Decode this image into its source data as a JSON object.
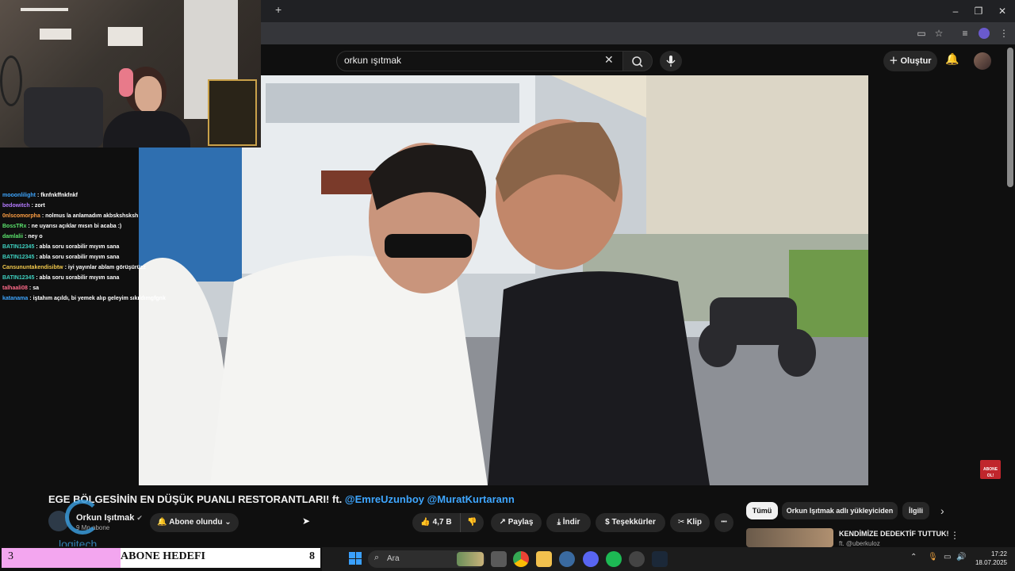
{
  "browser": {
    "new_tab": "+",
    "minimize": "–",
    "maximize": "❐",
    "close": "✕"
  },
  "youtube": {
    "search_value": "orkun ışıtmak",
    "create_label": "Oluştur",
    "video_title_main": "EGE BÖLGESİNİN EN DÜŞÜK PUANLI RESTORANTLARI! ft.",
    "video_title_tag1": "@EmreUzunboy",
    "video_title_tag2": "@MuratKurtarann",
    "channel_name": "Orkun Işıtmak",
    "channel_subs": "9 Mn abone",
    "subscribed_label": "Abone olundu",
    "likes": "4,7 B",
    "share": "Paylaş",
    "download": "İndir",
    "thanks": "Teşekkürler",
    "clip": "Klip",
    "more": "•••",
    "chips": [
      "Tümü",
      "Orkun Işıtmak adlı yükleyiciden",
      "İlgili"
    ],
    "rec_title": "KENDİMİZE DEDEKTİF TUTTUK!",
    "rec_sub": "ft. @uberkuloz",
    "sub_badge": "ABONE OL!"
  },
  "chat": [
    {
      "user": "mooonlilight",
      "msg": ": fknfnkffnkfnkf",
      "color": "#3ea6ff"
    },
    {
      "user": "bedowitch",
      "msg": ": zort",
      "color": "#b57bff"
    },
    {
      "user": "0nlscomorpha",
      "msg": ": nolmus la anlamadım akbskshsksh",
      "color": "#ff9f43"
    },
    {
      "user": "BossTRx",
      "msg": ": ne uyarısı açıklar mısın bi acaba :)",
      "color": "#5be36d"
    },
    {
      "user": "damlalii",
      "msg": ": ney o",
      "color": "#5be36d"
    },
    {
      "user": "BATIN12345",
      "msg": ": abla soru sorabilir mıyım sana",
      "color": "#3ed0c0"
    },
    {
      "user": "BATIN12345",
      "msg": ": abla soru sorabilir mıyım sana",
      "color": "#3ed0c0"
    },
    {
      "user": "Cansununtakendisibtw",
      "msg": ": iyi yayınlar ablam görüşürüzz",
      "color": "#f2c94c"
    },
    {
      "user": "BATIN12345",
      "msg": ": abla soru sorabilir mıyım sana",
      "color": "#3ed0c0"
    },
    {
      "user": "talhaali08",
      "msg": ": sa",
      "color": "#ff6b8a"
    },
    {
      "user": "katanama",
      "msg": ": iştahım açıldı, bi yemek alıp geleyim sıkıldımgfgnk",
      "color": "#3ea6ff"
    }
  ],
  "stream_logo": "logitech",
  "goal": {
    "current": "3",
    "label": "ABONE HEDEFI",
    "target": "8"
  },
  "taskbar": {
    "search_placeholder": "Ara",
    "time": "17:22",
    "date": "18.07.2025"
  },
  "colors": {
    "accent_link": "#3ea6ff",
    "goal_fill": "#f3a6ef",
    "youtube_bg": "#0f0f0f"
  }
}
